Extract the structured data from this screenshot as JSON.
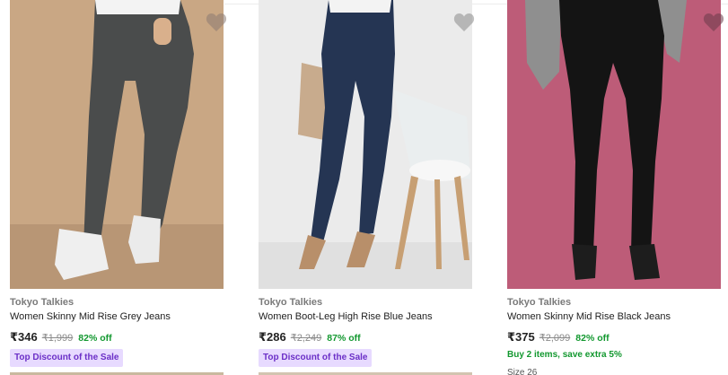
{
  "products": [
    {
      "brand": "Tokyo Talkies",
      "title": "Women Skinny Mid Rise Grey Jeans",
      "price": "₹346",
      "mrp": "₹1,999",
      "discount": "82% off",
      "badge": "Top Discount of the Sale",
      "image_bg": "#c9a784"
    },
    {
      "brand": "Tokyo Talkies",
      "title": "Women Boot-Leg High Rise Blue Jeans",
      "price": "₹286",
      "mrp": "₹2,249",
      "discount": "87% off",
      "badge": "Top Discount of the Sale",
      "image_bg": "#ebebeb"
    },
    {
      "brand": "Tokyo Talkies",
      "title": "Women Skinny Mid Rise Black Jeans",
      "price": "₹375",
      "mrp": "₹2,099",
      "discount": "82% off",
      "offer": "Buy 2 items, save extra 5%",
      "size": "Size 26",
      "image_bg": "#bd5c78"
    }
  ],
  "icons": {
    "wishlist": "heart-icon"
  },
  "colors": {
    "discount": "#12982f",
    "badge_bg": "#e7daff",
    "badge_text": "#6b2fc7"
  }
}
